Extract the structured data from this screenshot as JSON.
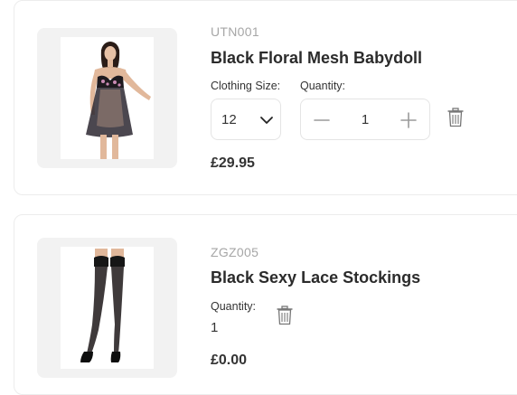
{
  "items": [
    {
      "sku": "UTN001",
      "title": "Black Floral Mesh Babydoll",
      "size_label": "Clothing Size:",
      "size_value": "12",
      "qty_label": "Quantity:",
      "qty_value": "1",
      "price": "£29.95",
      "image_icon": "babydoll-product-photo"
    },
    {
      "sku": "ZGZ005",
      "title": "Black Sexy Lace Stockings",
      "qty_label": "Quantity:",
      "qty_value": "1",
      "price": "£0.00",
      "image_icon": "stockings-product-photo"
    }
  ],
  "colors": {
    "border": "#e4e4e4",
    "image_bg": "#f2f2f2",
    "sku_text": "#a6a6a6",
    "icon_gray": "#9a9a9a"
  }
}
